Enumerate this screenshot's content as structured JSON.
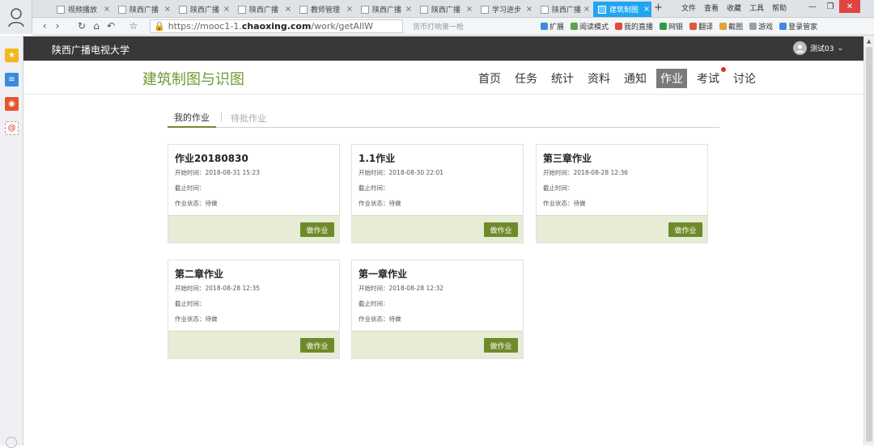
{
  "browser": {
    "tabs": [
      {
        "label": "视频播放",
        "active": false
      },
      {
        "label": "陕西广播",
        "active": false
      },
      {
        "label": "陕西广播",
        "active": false
      },
      {
        "label": "陕西广播",
        "active": false
      },
      {
        "label": "教师管理",
        "active": false
      },
      {
        "label": "陕西广播",
        "active": false
      },
      {
        "label": "陕西广播",
        "active": false
      },
      {
        "label": "学习进步",
        "active": false
      },
      {
        "label": "陕西广播",
        "active": false
      },
      {
        "label": "建筑制图",
        "active": true
      }
    ],
    "new_tab": "+",
    "menu": [
      "文件",
      "查看",
      "收藏",
      "工具",
      "帮助"
    ],
    "url_prefix": "https://mooc1-1.",
    "url_domain": "chaoxing.com",
    "url_path": "/work/getAllW",
    "search_placeholder": "货币打响第一枪",
    "toolbar": [
      {
        "label": "扩展",
        "color": "#3b8be0"
      },
      {
        "label": "阅读模式",
        "color": "#58a64a"
      },
      {
        "label": "我的直播",
        "color": "#e04a3a"
      },
      {
        "label": "网银",
        "color": "#2e9a46"
      },
      {
        "label": "翻译",
        "color": "#e05a3a"
      },
      {
        "label": "截图",
        "color": "#e0a43a"
      },
      {
        "label": "游戏",
        "color": "#9aa0a6"
      },
      {
        "label": "登录管家",
        "color": "#3b8be0"
      }
    ]
  },
  "site": {
    "name": "陕西广播电视大学",
    "user": "测试03"
  },
  "course": {
    "title": "建筑制图与识图",
    "nav": [
      {
        "label": "首页",
        "active": false
      },
      {
        "label": "任务",
        "active": false
      },
      {
        "label": "统计",
        "active": false
      },
      {
        "label": "资料",
        "active": false
      },
      {
        "label": "通知",
        "active": false
      },
      {
        "label": "作业",
        "active": true
      },
      {
        "label": "考试",
        "active": false,
        "dot": true
      },
      {
        "label": "讨论",
        "active": false
      }
    ]
  },
  "subtabs": {
    "mine": "我的作业",
    "pending": "待批作业"
  },
  "assignments": [
    {
      "title": "作业20180830",
      "start": "开始时间：2018-08-31 15:23",
      "end": "截止时间：",
      "status": "作业状态：待做",
      "button": "做作业"
    },
    {
      "title": "1.1作业",
      "start": "开始时间：2018-08-30 22:01",
      "end": "截止时间：",
      "status": "作业状态：待做",
      "button": "做作业"
    },
    {
      "title": "第三章作业",
      "start": "开始时间：2018-08-28 12:36",
      "end": "截止时间：",
      "status": "作业状态：待做",
      "button": "做作业"
    },
    {
      "title": "第二章作业",
      "start": "开始时间：2018-08-28 12:35",
      "end": "截止时间：",
      "status": "作业状态：待做",
      "button": "做作业"
    },
    {
      "title": "第一章作业",
      "start": "开始时间：2018-08-28 12:32",
      "end": "截止时间：",
      "status": "作业状态：待做",
      "button": "做作业"
    }
  ],
  "colors": {
    "accent": "#6e8a2a",
    "header_bg": "#383838",
    "active_tab": "#1fa5f2",
    "card_footer": "#e7ecd6"
  }
}
